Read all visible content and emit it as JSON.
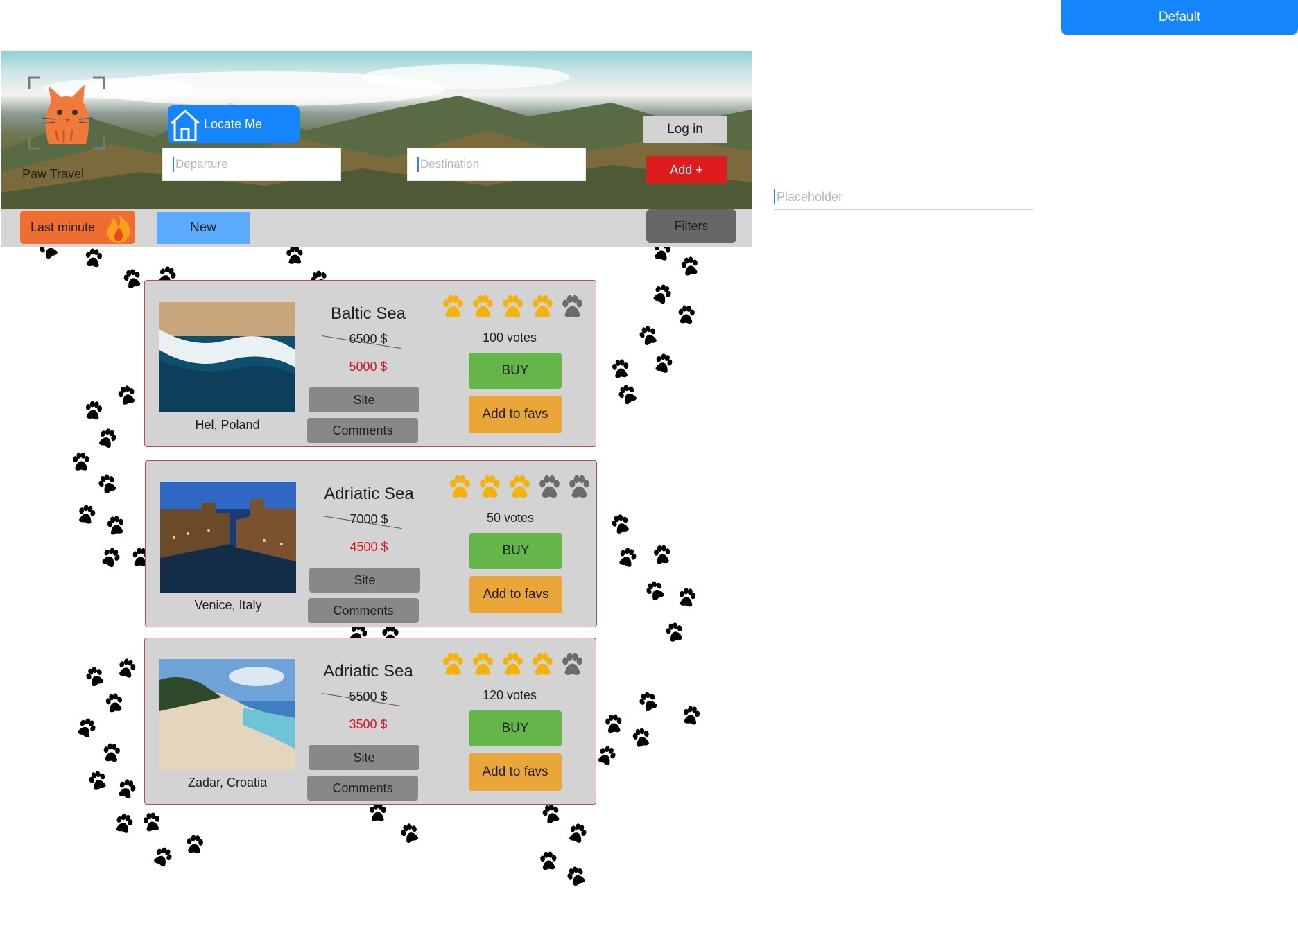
{
  "top_button": {
    "label": "Default"
  },
  "side_input": {
    "placeholder": "Placeholder"
  },
  "header": {
    "brand": "Paw Travel",
    "locate_label": "Locate Me",
    "departure_placeholder": "Departure",
    "destination_placeholder": "Destination",
    "login_label": "Log in",
    "add_label": "Add +"
  },
  "toolbar": {
    "last_minute_label": "Last minute",
    "new_label": "New",
    "filters_label": "Filters"
  },
  "colors": {
    "accent_blue": "#1585fb",
    "paw_filled": "#f4b20a",
    "paw_empty": "#6b6b6b",
    "buy_green": "#64b649",
    "fav_orange": "#eba63a",
    "price_red": "#e0141e"
  },
  "offers": [
    {
      "title": "Baltic Sea",
      "old_price": "6500 $",
      "new_price": "5000 $",
      "location": "Hel, Poland",
      "rating": 4,
      "rating_max": 5,
      "votes": "100 votes",
      "site_label": "Site",
      "comments_label": "Comments",
      "buy_label": "BUY",
      "fav_label": "Add to favs",
      "image": "beach-waves-photo"
    },
    {
      "title": "Adriatic Sea",
      "old_price": "7000 $",
      "new_price": "4500 $",
      "location": "Venice, Italy",
      "rating": 3,
      "rating_max": 5,
      "votes": "50 votes",
      "site_label": "Site",
      "comments_label": "Comments",
      "buy_label": "BUY",
      "fav_label": "Add to favs",
      "image": "venice-canal-photo"
    },
    {
      "title": "Adriatic Sea",
      "old_price": "5500 $",
      "new_price": "3500 $",
      "location": "Zadar, Croatia",
      "rating": 4,
      "rating_max": 5,
      "votes": "120 votes",
      "site_label": "Site",
      "comments_label": "Comments",
      "buy_label": "BUY",
      "fav_label": "Add to favs",
      "image": "sandy-beach-photo"
    }
  ]
}
